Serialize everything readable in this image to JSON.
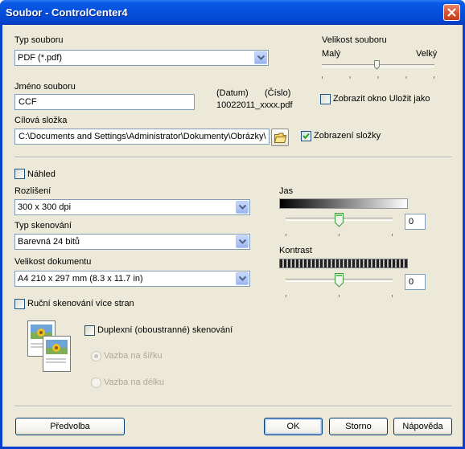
{
  "window": {
    "title": "Soubor - ControlCenter4"
  },
  "file_type": {
    "label": "Typ souboru",
    "value": "PDF (*.pdf)"
  },
  "file_size": {
    "label": "Velikost souboru",
    "min_label": "Malý",
    "max_label": "Velký",
    "level": 0.5
  },
  "file_name": {
    "label": "Jméno souboru",
    "value": "CCF",
    "date_header": "(Datum)",
    "number_header": "(Číslo)",
    "example": "10022011_xxxx.pdf"
  },
  "show_save_as": {
    "label": "Zobrazit okno Uložit jako",
    "checked": false
  },
  "target_folder": {
    "label": "Cílová složka",
    "value": "C:\\Documents and Settings\\Administrator\\Dokumenty\\Obrázky\\"
  },
  "show_folder": {
    "label": "Zobrazení složky",
    "checked": true
  },
  "preview": {
    "label": "Náhled",
    "checked": false
  },
  "resolution": {
    "label": "Rozlišení",
    "value": "300 x 300 dpi"
  },
  "scan_type": {
    "label": "Typ skenování",
    "value": "Barevná 24 bitů"
  },
  "document_size": {
    "label": "Velikost dokumentu",
    "value": "A4 210 x 297 mm (8.3 x 11.7 in)"
  },
  "manual_multipage": {
    "label": "Ruční skenování více stran",
    "checked": false
  },
  "duplex": {
    "label": "Duplexní (oboustranné) skenování",
    "checked": false
  },
  "binding": {
    "long_edge": "Vazba na šířku",
    "short_edge": "Vazba na délku"
  },
  "brightness": {
    "label": "Jas",
    "value": "0",
    "level": 0.5
  },
  "contrast": {
    "label": "Kontrast",
    "value": "0",
    "level": 0.5
  },
  "buttons": {
    "preset": "Předvolba",
    "ok": "OK",
    "cancel": "Storno",
    "help": "Nápověda"
  },
  "icons": [
    "close-icon",
    "dropdown-arrow-icon",
    "folder-icon",
    "checkmark-icon",
    "duplex-pages-icon",
    "slider-thumb-icon"
  ]
}
